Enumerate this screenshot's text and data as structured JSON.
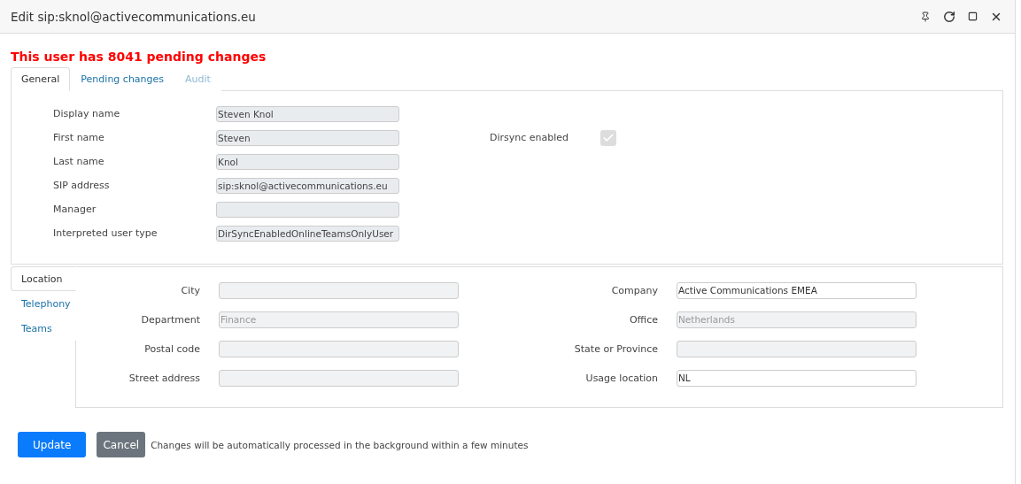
{
  "window": {
    "title": "Edit sip:sknol@activecommunications.eu"
  },
  "warning": "This user has 8041 pending changes",
  "tabs": [
    {
      "label": "General",
      "selected": true,
      "disabled": false
    },
    {
      "label": "Pending changes",
      "selected": false,
      "disabled": false
    },
    {
      "label": "Audit",
      "selected": false,
      "disabled": true
    }
  ],
  "general_fields": [
    {
      "label": "Display name",
      "value": "Steven Knol"
    },
    {
      "label": "First name",
      "value": "Steven"
    },
    {
      "label": "Last name",
      "value": "Knol"
    },
    {
      "label": "SIP address",
      "value": "sip:sknol@activecommunications.eu"
    },
    {
      "label": "Manager"
    },
    {
      "label": "Interpreted user type",
      "value": "DirSyncEnabledOnlineTeamsOnlyUser"
    }
  ],
  "dirsync": {
    "label": "Dirsync enabled",
    "checked": true
  },
  "side_tabs": [
    {
      "label": "Location",
      "selected": true
    },
    {
      "label": "Telephony",
      "selected": false
    },
    {
      "label": "Teams",
      "selected": false
    }
  ],
  "location_left": [
    {
      "label": "City",
      "disabled": true
    },
    {
      "label": "Department",
      "value": "Finance",
      "disabled": true
    },
    {
      "label": "Postal code",
      "disabled": true
    },
    {
      "label": "Street address",
      "disabled": true
    }
  ],
  "location_right": [
    {
      "label": "Company",
      "value": "Active Communications EMEA",
      "disabled": false
    },
    {
      "label": "Office",
      "value": "Netherlands",
      "disabled": true
    },
    {
      "label": "State or Province",
      "disabled": true
    },
    {
      "label": "Usage location",
      "value": "NL",
      "disabled": false
    }
  ],
  "buttons": [
    {
      "label": "Update",
      "kind": "primary"
    },
    {
      "label": "Cancel",
      "kind": "secondary"
    }
  ],
  "note": "Changes will be automatically processed in the background within a few minutes"
}
